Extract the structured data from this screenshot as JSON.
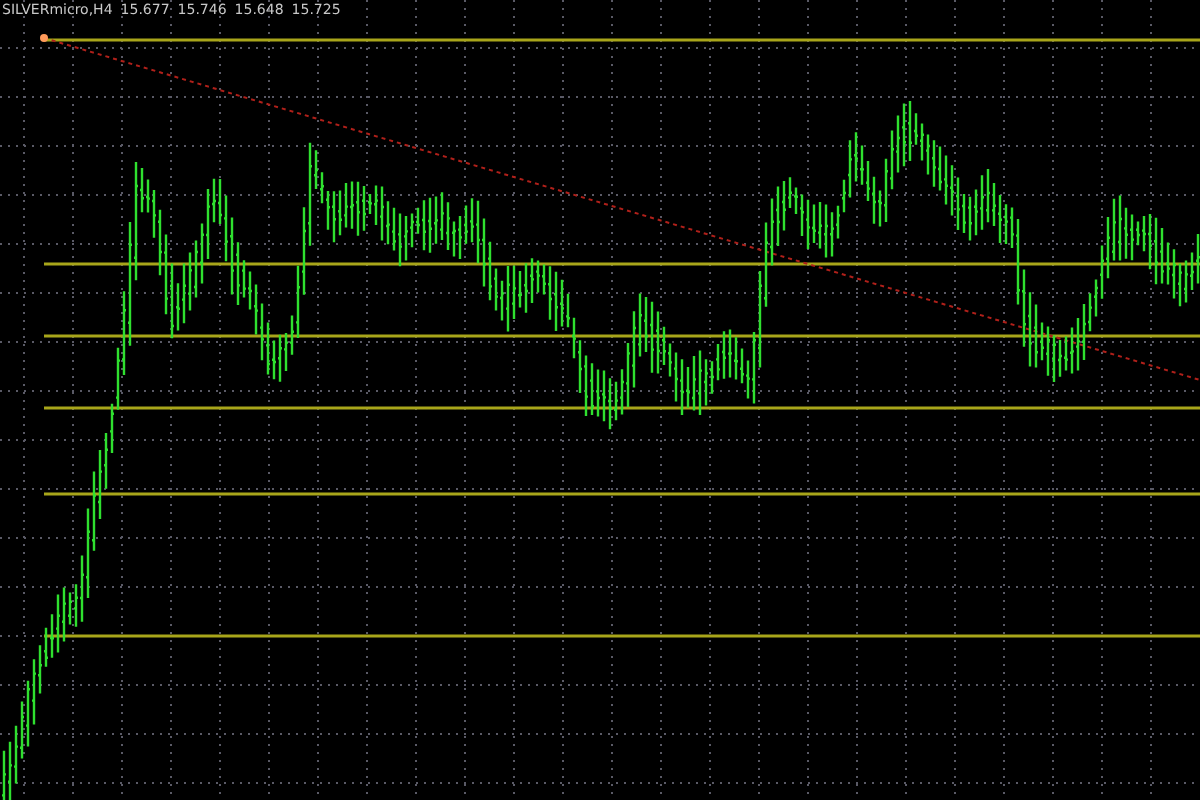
{
  "chart_header": {
    "symbol": "SILVERmicro,H4",
    "prices": [
      "15.677",
      "15.746",
      "15.648",
      "15.725"
    ]
  }
}
